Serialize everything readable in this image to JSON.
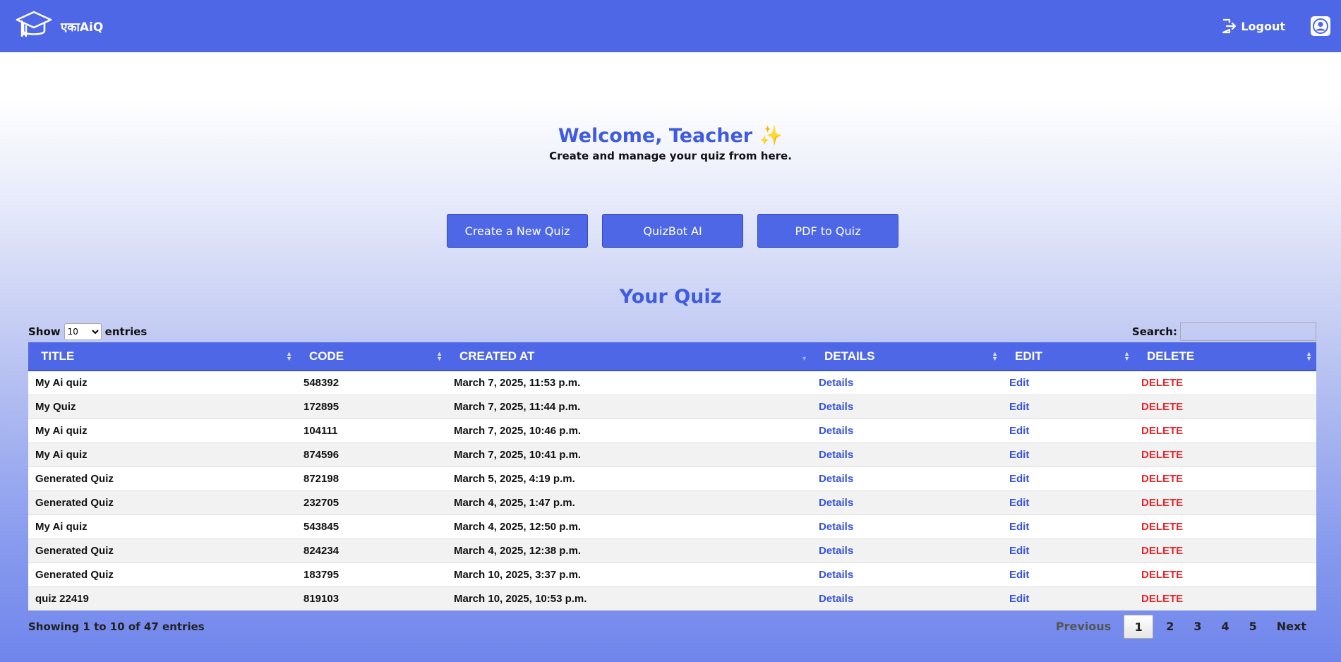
{
  "brand": {
    "name": "एकाAiQ",
    "icon": "graduation-cap-icon"
  },
  "nav": {
    "logout_label": "Logout",
    "logout_icon": "logout-icon",
    "profile_icon": "user-icon"
  },
  "welcome": {
    "title": "Welcome, Teacher",
    "emoji": "✨",
    "subtitle": "Create and manage your quiz from here."
  },
  "actions": {
    "create": "Create a New Quiz",
    "quizbot": "QuizBot AI",
    "pdf": "PDF to Quiz"
  },
  "section_title": "Your Quiz",
  "table_controls": {
    "show_label": "Show",
    "entries_label": "entries",
    "length_value": "10",
    "length_options": [
      "10"
    ],
    "search_label": "Search:",
    "search_value": ""
  },
  "table": {
    "columns": [
      "TITLE",
      "CODE",
      "CREATED AT",
      "DETAILS",
      "EDIT",
      "DELETE"
    ],
    "rows": [
      {
        "title": "My Ai quiz",
        "code": "548392",
        "created": "March 7, 2025, 11:53 p.m.",
        "details": "Details",
        "edit": "Edit",
        "delete": "DELETE"
      },
      {
        "title": "My Quiz",
        "code": "172895",
        "created": "March 7, 2025, 11:44 p.m.",
        "details": "Details",
        "edit": "Edit",
        "delete": "DELETE"
      },
      {
        "title": "My Ai quiz",
        "code": "104111",
        "created": "March 7, 2025, 10:46 p.m.",
        "details": "Details",
        "edit": "Edit",
        "delete": "DELETE"
      },
      {
        "title": "My Ai quiz",
        "code": "874596",
        "created": "March 7, 2025, 10:41 p.m.",
        "details": "Details",
        "edit": "Edit",
        "delete": "DELETE"
      },
      {
        "title": "Generated Quiz",
        "code": "872198",
        "created": "March 5, 2025, 4:19 p.m.",
        "details": "Details",
        "edit": "Edit",
        "delete": "DELETE"
      },
      {
        "title": "Generated Quiz",
        "code": "232705",
        "created": "March 4, 2025, 1:47 p.m.",
        "details": "Details",
        "edit": "Edit",
        "delete": "DELETE"
      },
      {
        "title": "My Ai quiz",
        "code": "543845",
        "created": "March 4, 2025, 12:50 p.m.",
        "details": "Details",
        "edit": "Edit",
        "delete": "DELETE"
      },
      {
        "title": "Generated Quiz",
        "code": "824234",
        "created": "March 4, 2025, 12:38 p.m.",
        "details": "Details",
        "edit": "Edit",
        "delete": "DELETE"
      },
      {
        "title": "Generated Quiz",
        "code": "183795",
        "created": "March 10, 2025, 3:37 p.m.",
        "details": "Details",
        "edit": "Edit",
        "delete": "DELETE"
      },
      {
        "title": "quiz 22419",
        "code": "819103",
        "created": "March 10, 2025, 10:53 p.m.",
        "details": "Details",
        "edit": "Edit",
        "delete": "DELETE"
      }
    ]
  },
  "info": "Showing 1 to 10 of 47 entries",
  "pagination": {
    "previous": "Previous",
    "pages": [
      "1",
      "2",
      "3",
      "4",
      "5"
    ],
    "current": "1",
    "next": "Next"
  },
  "colors": {
    "primary": "#4e67e6",
    "heading": "#3f5be0",
    "link": "#3653d8",
    "delete": "#e0272b"
  }
}
